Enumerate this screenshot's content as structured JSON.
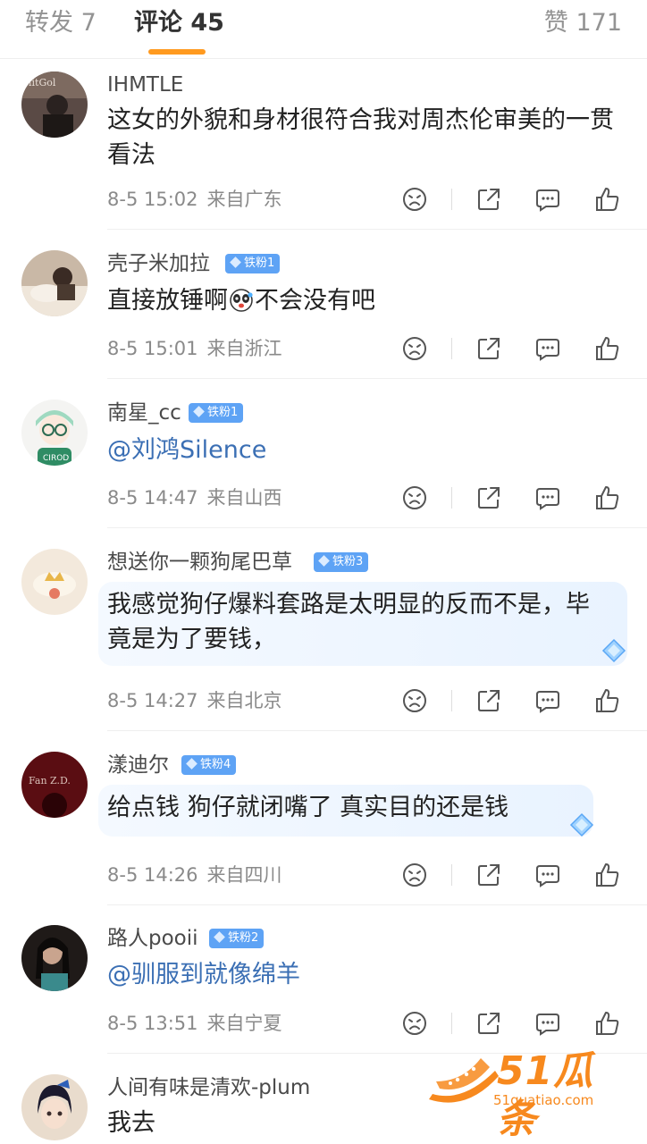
{
  "tabs": {
    "repost": "转发 7",
    "comments": "评论 45",
    "likes": "赞 171"
  },
  "comments": [
    {
      "username": "IHMTLE",
      "badge": "",
      "text": "这女的外貌和身材很符合我对周杰伦审美的一贯看法",
      "time": "8-5 15:02",
      "location": "来自广东"
    },
    {
      "username": "壳子米加拉",
      "badge": "铁粉1",
      "text_before": "直接放锤啊",
      "text_after": "不会没有吧",
      "time": "8-5 15:01",
      "location": "来自浙江"
    },
    {
      "username": "南星_cc",
      "badge": "铁粉1",
      "text": "@刘鸿Silence",
      "time": "8-5 14:47",
      "location": "来自山西"
    },
    {
      "username": "想送你一颗狗尾巴草",
      "badge": "铁粉3",
      "text": "我感觉狗仔爆料套路是太明显的反而不是，毕竟是为了要钱，",
      "time": "8-5 14:27",
      "location": "来自北京"
    },
    {
      "username": "漾迪尔",
      "badge": "铁粉4",
      "text": "给点钱 狗仔就闭嘴了 真实目的还是钱",
      "time": "8-5 14:26",
      "location": "来自四川"
    },
    {
      "username": "路人pooii",
      "badge": "铁粉2",
      "text": "@驯服到就像绵羊",
      "time": "8-5 13:51",
      "location": "来自宁夏"
    },
    {
      "username": "人间有味是清欢-plum",
      "badge": "",
      "text": "我去"
    }
  ],
  "watermark": {
    "brand": "51瓜条",
    "domain": "51guatiao.com"
  },
  "colors": {
    "accent": "#ff9a1f",
    "badge": "#5ea3f5",
    "mention": "#3b6fb4",
    "meta": "#8a8a8a"
  },
  "icons": [
    "dislike-icon",
    "share-icon",
    "comment-icon",
    "like-icon",
    "diamond-sticker-icon"
  ]
}
